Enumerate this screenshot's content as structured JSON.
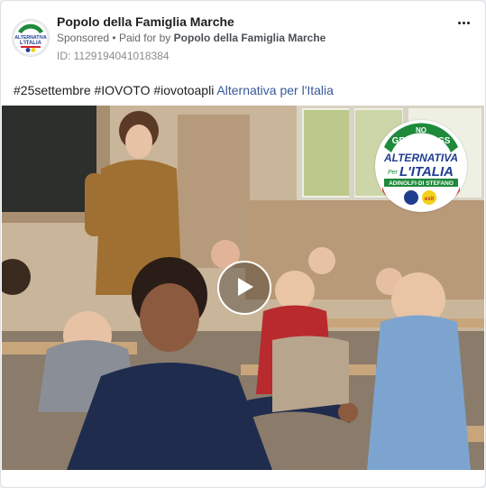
{
  "post": {
    "page_name": "Popolo della Famiglia Marche",
    "sponsored_label": "Sponsored",
    "paid_for_prefix": "Paid for by",
    "paid_for_by": "Popolo della Famiglia Marche",
    "id_label": "ID: 1129194041018384",
    "caption_text": "#25settembre #IOVOTO #iovotoapli ",
    "caption_link": "Alternativa per l'Italia"
  },
  "video": {
    "badge": {
      "line1": "NO",
      "line2": "GREEN PASS",
      "line3": "ALTERNATIVA",
      "line4_small": "Per",
      "line4": "L'ITALIA",
      "line5": "ADINOLFI·DI STEFANO",
      "logo_exit": "exit"
    }
  },
  "avatar_logo": {
    "line1": "ALTERNATIVA",
    "line2": "L'ITALIA"
  },
  "colors": {
    "green": "#1e8a3a",
    "blue": "#1f3c8f",
    "yellow": "#f2d21b",
    "red": "#d7262e"
  }
}
